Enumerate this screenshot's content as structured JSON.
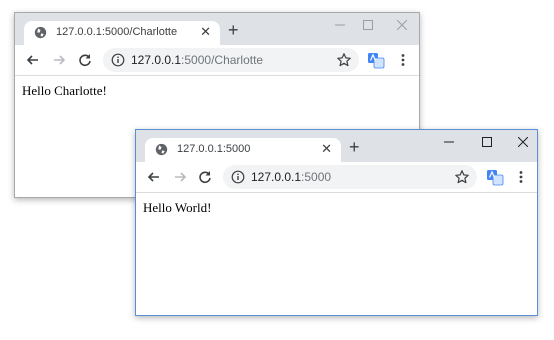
{
  "windows": [
    {
      "tab_title": "127.0.0.1:5000/Charlotte",
      "url_host": "127.0.0.1",
      "url_path": ":5000/Charlotte",
      "page_text": "Hello Charlotte!"
    },
    {
      "tab_title": "127.0.0.1:5000",
      "url_host": "127.0.0.1",
      "url_path": ":5000",
      "page_text": "Hello World!"
    }
  ],
  "tab_close_glyph": "✕",
  "new_tab_glyph": "+",
  "icons": {
    "favicon": "globe-icon",
    "info": "info-icon",
    "star": "star-icon",
    "extension": "translate-extension-icon",
    "menu": "kebab-menu-icon"
  },
  "colors": {
    "titlebar": "#dee1e6",
    "omnibox": "#f1f3f4",
    "front_border": "#5b8fd3",
    "back_border": "#a9a9a9"
  }
}
